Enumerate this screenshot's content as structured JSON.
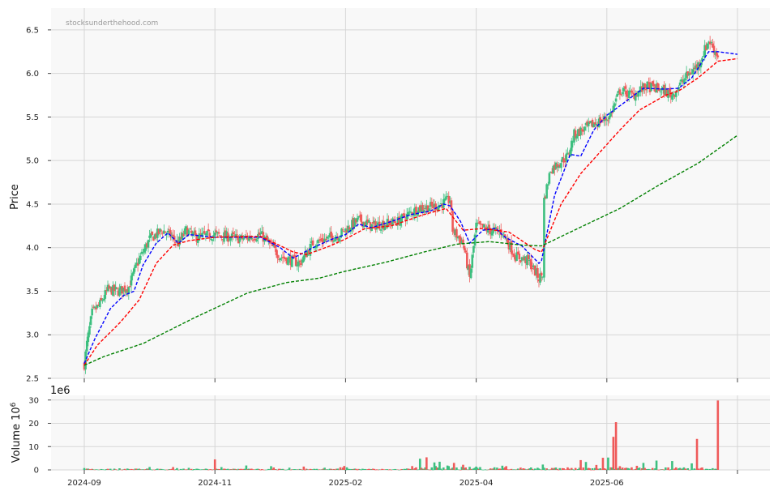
{
  "watermark": "stocksunderthehood.com",
  "colors": {
    "up": "#3dbf7f",
    "down": "#ef5a5a",
    "ma_short": "#0000ff",
    "ma_mid": "#ff0000",
    "ma_long": "#008000",
    "panel_bg": "#f8f8f8",
    "grid": "#d6d6d6"
  },
  "chart_data": [
    {
      "type": "candlestick",
      "ylabel": "Price",
      "ylim": [
        2.5,
        6.75
      ],
      "yticks": [
        "2.5",
        "3.0",
        "3.5",
        "4.0",
        "4.5",
        "5.0",
        "5.5",
        "6.0",
        "6.5"
      ],
      "xlim": [
        0,
        505
      ],
      "xticks": [
        {
          "t": 0,
          "label": "2024-09"
        },
        {
          "t": 100,
          "label": "2024-11"
        },
        {
          "t": 200,
          "label": "2025-02"
        },
        {
          "t": 300,
          "label": "2025-04"
        },
        {
          "t": 400,
          "label": "2025-06"
        },
        {
          "t": 500,
          "label": ""
        }
      ],
      "grid": true,
      "price_keypoints": [
        [
          0,
          2.66
        ],
        [
          2,
          2.9
        ],
        [
          6,
          3.25
        ],
        [
          12,
          3.35
        ],
        [
          18,
          3.52
        ],
        [
          26,
          3.5
        ],
        [
          34,
          3.55
        ],
        [
          40,
          3.8
        ],
        [
          50,
          4.1
        ],
        [
          60,
          4.2
        ],
        [
          65,
          4.15
        ],
        [
          72,
          4.05
        ],
        [
          78,
          4.2
        ],
        [
          85,
          4.12
        ],
        [
          100,
          4.15
        ],
        [
          120,
          4.1
        ],
        [
          135,
          4.15
        ],
        [
          150,
          3.9
        ],
        [
          165,
          3.82
        ],
        [
          175,
          4.05
        ],
        [
          195,
          4.15
        ],
        [
          210,
          4.32
        ],
        [
          220,
          4.25
        ],
        [
          240,
          4.3
        ],
        [
          255,
          4.45
        ],
        [
          270,
          4.48
        ],
        [
          280,
          4.55
        ],
        [
          282,
          4.2
        ],
        [
          290,
          4.05
        ],
        [
          295,
          3.65
        ],
        [
          300,
          4.25
        ],
        [
          310,
          4.2
        ],
        [
          320,
          4.18
        ],
        [
          330,
          3.9
        ],
        [
          340,
          3.85
        ],
        [
          348,
          3.65
        ],
        [
          351,
          3.7
        ],
        [
          352,
          4.55
        ],
        [
          357,
          4.9
        ],
        [
          370,
          5.05
        ],
        [
          375,
          5.3
        ],
        [
          390,
          5.42
        ],
        [
          402,
          5.5
        ],
        [
          410,
          5.8
        ],
        [
          420,
          5.75
        ],
        [
          430,
          5.85
        ],
        [
          440,
          5.82
        ],
        [
          450,
          5.75
        ],
        [
          460,
          5.95
        ],
        [
          470,
          6.1
        ],
        [
          478,
          6.38
        ],
        [
          482,
          6.28
        ],
        [
          485,
          6.2
        ]
      ],
      "series": [
        {
          "name": "",
          "points": [
            [
              0,
              2.67
            ],
            [
              8,
              2.95
            ],
            [
              20,
              3.3
            ],
            [
              30,
              3.45
            ],
            [
              38,
              3.5
            ],
            [
              45,
              3.8
            ],
            [
              55,
              4.05
            ],
            [
              64,
              4.17
            ],
            [
              72,
              4.05
            ],
            [
              80,
              4.15
            ],
            [
              100,
              4.12
            ],
            [
              135,
              4.12
            ],
            [
              150,
              4.0
            ],
            [
              160,
              3.88
            ],
            [
              175,
              4.0
            ],
            [
              190,
              4.1
            ],
            [
              200,
              4.15
            ],
            [
              210,
              4.27
            ],
            [
              220,
              4.23
            ],
            [
              235,
              4.3
            ],
            [
              250,
              4.38
            ],
            [
              265,
              4.42
            ],
            [
              275,
              4.5
            ],
            [
              280,
              4.48
            ],
            [
              288,
              4.3
            ],
            [
              295,
              4.05
            ],
            [
              305,
              4.2
            ],
            [
              315,
              4.22
            ],
            [
              322,
              4.12
            ],
            [
              335,
              4.02
            ],
            [
              348,
              3.82
            ],
            [
              350,
              3.85
            ],
            [
              360,
              4.6
            ],
            [
              372,
              5.07
            ],
            [
              380,
              5.05
            ],
            [
              390,
              5.35
            ],
            [
              400,
              5.52
            ],
            [
              412,
              5.65
            ],
            [
              428,
              5.83
            ],
            [
              445,
              5.82
            ],
            [
              455,
              5.83
            ],
            [
              465,
              5.95
            ],
            [
              478,
              6.25
            ],
            [
              485,
              6.25
            ],
            [
              500,
              6.22
            ]
          ]
        },
        {
          "name": "",
          "points": [
            [
              0,
              2.65
            ],
            [
              10,
              2.88
            ],
            [
              28,
              3.15
            ],
            [
              42,
              3.4
            ],
            [
              55,
              3.82
            ],
            [
              68,
              4.03
            ],
            [
              80,
              4.08
            ],
            [
              100,
              4.12
            ],
            [
              135,
              4.13
            ],
            [
              160,
              3.95
            ],
            [
              170,
              3.92
            ],
            [
              188,
              4.02
            ],
            [
              200,
              4.1
            ],
            [
              215,
              4.22
            ],
            [
              235,
              4.25
            ],
            [
              260,
              4.38
            ],
            [
              277,
              4.45
            ],
            [
              290,
              4.2
            ],
            [
              305,
              4.22
            ],
            [
              325,
              4.18
            ],
            [
              345,
              3.98
            ],
            [
              350,
              3.95
            ],
            [
              365,
              4.5
            ],
            [
              380,
              4.85
            ],
            [
              395,
              5.1
            ],
            [
              410,
              5.35
            ],
            [
              425,
              5.58
            ],
            [
              445,
              5.75
            ],
            [
              455,
              5.8
            ],
            [
              470,
              5.95
            ],
            [
              485,
              6.14
            ],
            [
              500,
              6.17
            ]
          ]
        },
        {
          "name": "",
          "points": [
            [
              0,
              2.65
            ],
            [
              15,
              2.75
            ],
            [
              45,
              2.9
            ],
            [
              85,
              3.2
            ],
            [
              125,
              3.48
            ],
            [
              155,
              3.6
            ],
            [
              180,
              3.65
            ],
            [
              200,
              3.73
            ],
            [
              230,
              3.83
            ],
            [
              260,
              3.95
            ],
            [
              285,
              4.04
            ],
            [
              310,
              4.07
            ],
            [
              335,
              4.03
            ],
            [
              350,
              4.02
            ],
            [
              375,
              4.2
            ],
            [
              410,
              4.45
            ],
            [
              440,
              4.72
            ],
            [
              470,
              4.97
            ],
            [
              500,
              5.29
            ]
          ]
        }
      ]
    },
    {
      "type": "bar",
      "ylabel": "Volume  10",
      "ylabel_exponent": "6",
      "offset_text": "1e6",
      "ylim": [
        0,
        32
      ],
      "yticks": [
        "0",
        "10",
        "20",
        "30"
      ],
      "volume_spikes": [
        [
          0,
          0.8
        ],
        [
          100,
          4.5
        ],
        [
          170,
          0.5
        ],
        [
          257,
          4.8
        ],
        [
          262,
          5.4
        ],
        [
          268,
          3.2
        ],
        [
          272,
          3.5
        ],
        [
          283,
          3.0
        ],
        [
          290,
          2.2
        ],
        [
          303,
          1.2
        ],
        [
          320,
          1.8
        ],
        [
          351,
          2.3
        ],
        [
          380,
          4.2
        ],
        [
          384,
          3.4
        ],
        [
          397,
          5.2
        ],
        [
          401,
          5.3
        ],
        [
          405,
          14.2
        ],
        [
          407,
          20.5
        ],
        [
          410,
          1.6
        ],
        [
          428,
          3.0
        ],
        [
          438,
          4.0
        ],
        [
          450,
          3.8
        ],
        [
          465,
          2.8
        ],
        [
          469,
          13.3
        ],
        [
          485,
          29.8
        ]
      ]
    }
  ]
}
